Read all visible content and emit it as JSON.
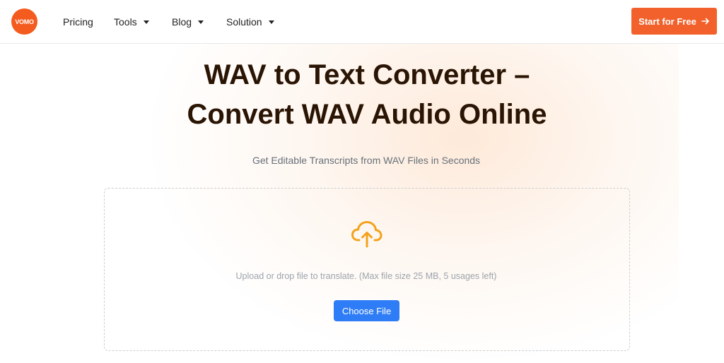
{
  "brand": {
    "logo_text": "VOMO",
    "color": "#f45b1e"
  },
  "nav": {
    "items": [
      {
        "label": "Pricing",
        "has_dropdown": false
      },
      {
        "label": "Tools",
        "has_dropdown": true
      },
      {
        "label": "Blog",
        "has_dropdown": true
      },
      {
        "label": "Solution",
        "has_dropdown": true
      }
    ],
    "cta_label": "Start for Free",
    "cta_icon": "arrow-right-icon",
    "cta_color": "#f2612b"
  },
  "hero": {
    "title_line1": "WAV to Text Converter –",
    "title_line2": "Convert WAV Audio Online",
    "subtitle": "Get Editable Transcripts from WAV Files in Seconds"
  },
  "upload": {
    "icon": "cloud-upload-icon",
    "icon_color": "#f4a21b",
    "hint": "Upload or drop file to translate. (Max file size 25 MB, 5 usages left)",
    "button_label": "Choose File",
    "button_color": "#2f7df6"
  }
}
